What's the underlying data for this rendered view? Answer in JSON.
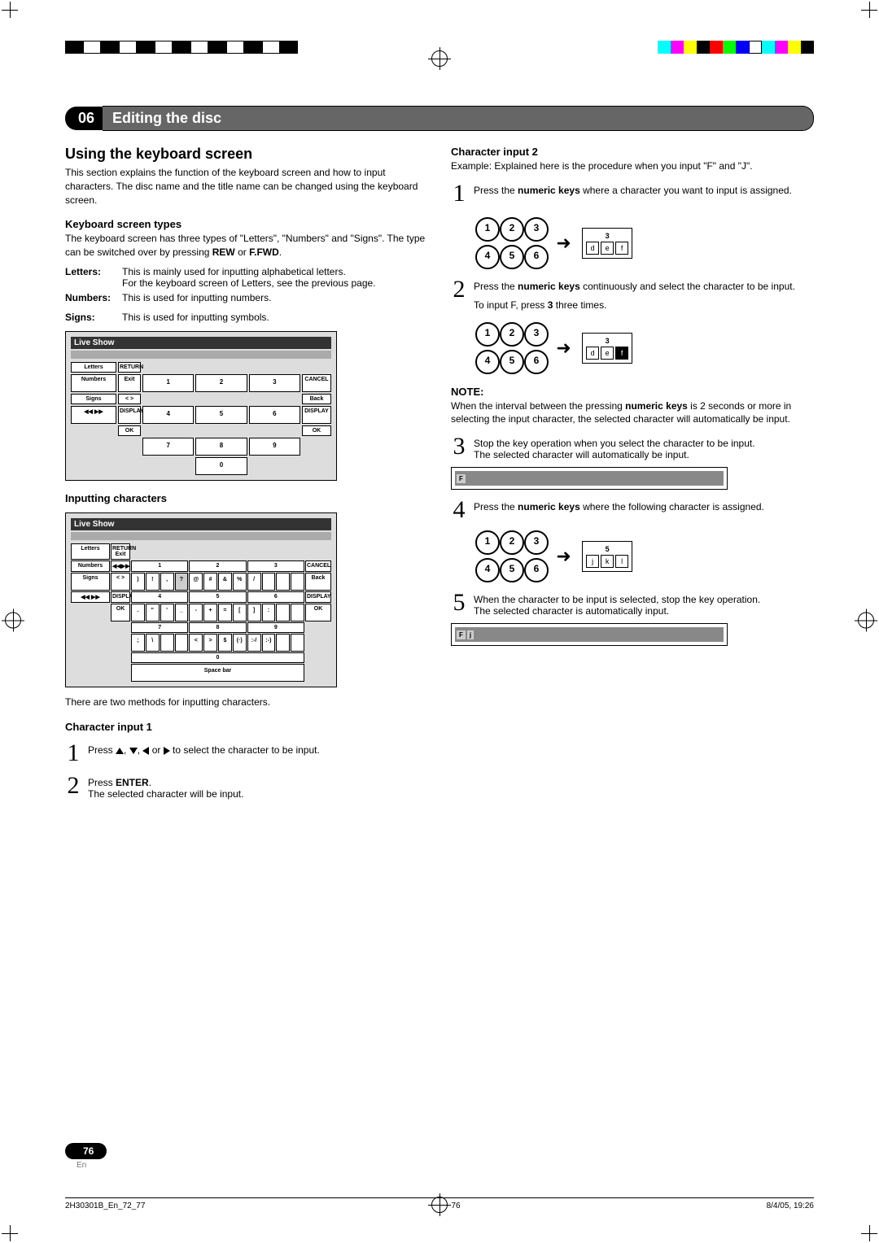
{
  "chapter": {
    "number": "06",
    "title": "Editing the disc"
  },
  "left": {
    "h2": "Using the keyboard screen",
    "intro": "This section explains the function of the keyboard screen and how to input characters. The disc name and the title name can be changed using the keyboard screen.",
    "h3_types": "Keyboard screen types",
    "types_p1": "The keyboard screen has three types of \"Letters\", \"Numbers\" and \"Signs\". The type can be switched over by pressing ",
    "types_rew": "REW",
    "types_or": " or ",
    "types_ffwd": "F.FWD",
    "types_period": ".",
    "defs": {
      "letters": {
        "term": "Letters:",
        "body1": "This is mainly used for inputting alphabetical letters.",
        "body2": "For the keyboard screen of Letters, see the previous page."
      },
      "numbers": {
        "term": "Numbers:",
        "body": "This is used for inputting numbers."
      },
      "signs": {
        "term": "Signs:",
        "body": "This is used for inputting symbols."
      }
    },
    "shot1": {
      "title": "Live Show",
      "tabs": [
        "Letters",
        "Numbers",
        "Signs"
      ],
      "side": [
        "RETURN",
        "Exit",
        "◀◀ ▶▶",
        "< >",
        "DISPLAY",
        "OK"
      ],
      "grid": [
        "1",
        "2",
        "3",
        "4",
        "5",
        "6",
        "7",
        "8",
        "9",
        "0"
      ],
      "right": [
        "CANCEL",
        "Back",
        "DISPLAY",
        "OK"
      ]
    },
    "h3_input": "Inputting characters",
    "shot2": {
      "title": "Live Show",
      "spacebar": "Space bar"
    },
    "two_methods": "There are two methods for inputting characters.",
    "ci1_h": "Character input 1",
    "ci1_step1_a": "Press ",
    "ci1_step1_b": " to select the character to be input.",
    "ci1_arrows_sep": ", ",
    "ci1_arrows_or": " or ",
    "ci1_step2_a": "Press ",
    "ci1_step2_enter": "ENTER",
    "ci1_step2_b": ".",
    "ci1_step2_c": "The selected character will be input."
  },
  "right": {
    "ci2_h": "Character input 2",
    "ci2_intro": "Example: Explained here is the procedure when you input \"F\" and \"J\".",
    "step1_a": "Press the ",
    "step1_b": "numeric keys",
    "step1_c": " where a character you want to input is assigned.",
    "pad1_hint": {
      "top": "3",
      "keys": [
        "d",
        "e",
        "f"
      ],
      "hl": -1
    },
    "step2_a": "Press the ",
    "step2_b": "numeric keys",
    "step2_c": " continuously and select the character to be input.",
    "step2_extra_a": "To input F, press ",
    "step2_extra_b": "3",
    "step2_extra_c": " three times.",
    "pad2_hint": {
      "top": "3",
      "keys": [
        "d",
        "e",
        "f"
      ],
      "hl": 2
    },
    "note_h": "NOTE:",
    "note_a": "When the interval between the pressing ",
    "note_b": "numeric keys",
    "note_c": " is 2 seconds or more in selecting the input character, the selected character will automatically be input.",
    "step3_a": "Stop the key operation when you select the character to be input.",
    "step3_b": "The selected character will automatically be input.",
    "bar1": [
      "F"
    ],
    "step4_a": "Press the ",
    "step4_b": "numeric keys",
    "step4_c": " where the following character is assigned.",
    "pad4_hint": {
      "top": "5",
      "keys": [
        "j",
        "k",
        "l"
      ],
      "hl": -1
    },
    "step5_a": "When the character to be input is selected, stop the key operation.",
    "step5_b": "The selected character is automatically input.",
    "bar2": [
      "F",
      "j"
    ]
  },
  "numpad": [
    "1",
    "2",
    "3",
    "4",
    "5",
    "6"
  ],
  "page": {
    "num": "76",
    "lang": "En"
  },
  "footer": {
    "file": "2H30301B_En_72_77",
    "page": "76",
    "date": "8/4/05, 19:26"
  }
}
